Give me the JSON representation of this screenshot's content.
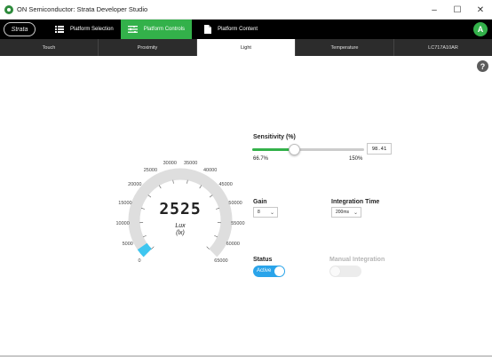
{
  "window": {
    "title": "ON Semiconductor: Strata Developer Studio",
    "minimize_glyph": "–",
    "maximize_glyph": "☐",
    "close_glyph": "✕"
  },
  "nav": {
    "logo_text": "Strata",
    "buttons": [
      {
        "label": "Platform Selection",
        "icon": "list-icon"
      },
      {
        "label": "Platform Controls",
        "icon": "sliders-icon"
      },
      {
        "label": "Platform Content",
        "icon": "document-icon"
      }
    ],
    "active_button": "Platform Controls",
    "user_initial": "A"
  },
  "tabs": [
    "Touch",
    "Proximity",
    "Light",
    "Temperature",
    "LC717A10AR"
  ],
  "active_tab": "Light",
  "help_glyph": "?",
  "gauge": {
    "value": "2525",
    "unit_line1": "Lux",
    "unit_line2": "(lx)",
    "ticks": [
      "0",
      "5000",
      "10000",
      "15000",
      "20000",
      "25000",
      "30000",
      "35000",
      "40000",
      "45000",
      "50000",
      "55000",
      "60000",
      "65000"
    ],
    "min": 0,
    "max": 65000,
    "current": 2525,
    "fill_color": "#3ec6f0",
    "track_color": "#dedede"
  },
  "sensitivity": {
    "label": "Sensitivity (%)",
    "value_text": "98.41",
    "min_label": "66.7%",
    "max_label": "150%",
    "fraction": 0.38
  },
  "gain": {
    "label": "Gain",
    "selected": "8"
  },
  "integration_time": {
    "label": "Integration Time",
    "selected": "200ms"
  },
  "status": {
    "label": "Status",
    "toggle_text": "Active",
    "on": true
  },
  "manual_integration": {
    "label": "Manual Integration",
    "on": false
  },
  "colors": {
    "accent_green": "#33b14a",
    "toggle_blue": "#2aa4ea",
    "nav_background": "#000000"
  }
}
